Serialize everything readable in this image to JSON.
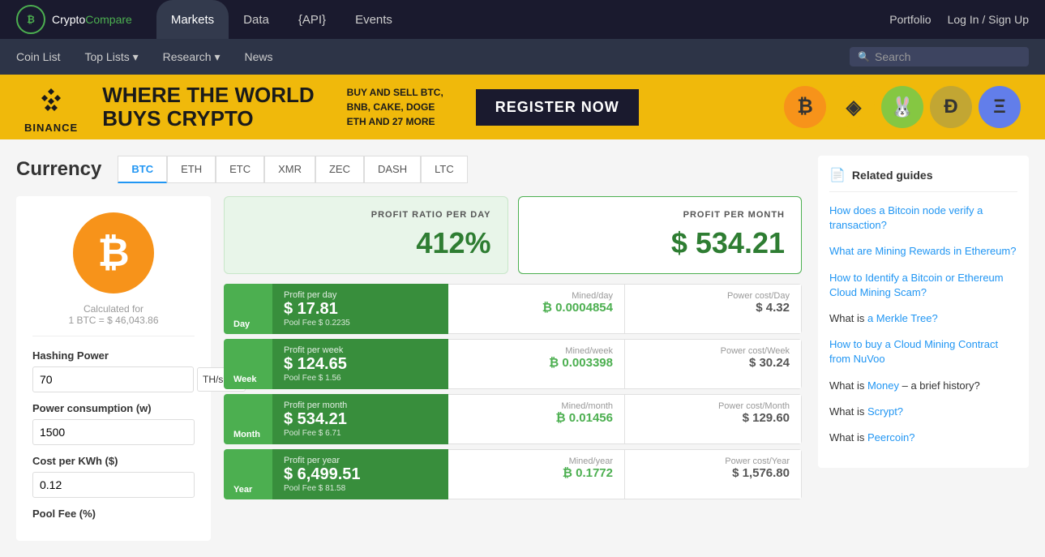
{
  "logo": {
    "crypto": "Crypto",
    "compare": "Compare",
    "icon": "₿"
  },
  "topNav": {
    "items": [
      {
        "label": "Markets",
        "active": true
      },
      {
        "label": "Data",
        "active": false
      },
      {
        "label": "{API}",
        "active": false
      },
      {
        "label": "Events",
        "active": false
      }
    ],
    "right": {
      "portfolio": "Portfolio",
      "login": "Log In / Sign Up"
    }
  },
  "secondaryNav": {
    "items": [
      {
        "label": "Coin List"
      },
      {
        "label": "Top Lists ▾"
      },
      {
        "label": "Research ▾"
      },
      {
        "label": "News"
      }
    ],
    "search": {
      "placeholder": "Search"
    }
  },
  "banner": {
    "binance": "BINANCE",
    "headline_line1": "WHERE THE WORLD",
    "headline_line2": "BUYS CRYPTO",
    "subtitle_line1": "BUY AND SELL BTC,",
    "subtitle_line2": "BNB, CAKE, DOGE",
    "subtitle_line3": "ETH AND 27 MORE",
    "cta": "REGISTER NOW",
    "coins": [
      "₿",
      "◈",
      "🐰",
      "Ð",
      "Ξ"
    ]
  },
  "currency": {
    "title": "Currency",
    "tabs": [
      "BTC",
      "ETH",
      "ETC",
      "XMR",
      "ZEC",
      "DASH",
      "LTC"
    ],
    "activeTab": "BTC"
  },
  "calculator": {
    "btcSymbol": "₿",
    "calculatedFor": "Calculated for",
    "btcRate": "1 BTC = $ 46,043.86",
    "hashingPower": {
      "label": "Hashing Power",
      "value": "70",
      "unit": "TH/s"
    },
    "powerConsumption": {
      "label": "Power consumption (w)",
      "value": "1500"
    },
    "costPerKwh": {
      "label": "Cost per KWh ($)",
      "value": "0.12"
    },
    "poolFee": {
      "label": "Pool Fee (%)"
    }
  },
  "profitBoxes": {
    "ratio": {
      "label": "PROFIT RATIO PER DAY",
      "value": "412%"
    },
    "monthly": {
      "label": "PROFIT PER MONTH",
      "value": "$ 534.21"
    }
  },
  "dataRows": [
    {
      "period": "Day",
      "profitLabel": "Profit per day",
      "profitValue": "$ 17.81",
      "poolFee": "Pool Fee $ 0.2235",
      "minedLabel": "Mined/day",
      "minedValue": "₿ 0.0004854",
      "costLabel": "Power cost/Day",
      "costValue": "$ 4.32"
    },
    {
      "period": "Week",
      "profitLabel": "Profit per week",
      "profitValue": "$ 124.65",
      "poolFee": "Pool Fee $ 1.56",
      "minedLabel": "Mined/week",
      "minedValue": "₿ 0.003398",
      "costLabel": "Power cost/Week",
      "costValue": "$ 30.24"
    },
    {
      "period": "Month",
      "profitLabel": "Profit per month",
      "profitValue": "$ 534.21",
      "poolFee": "Pool Fee $ 6.71",
      "minedLabel": "Mined/month",
      "minedValue": "₿ 0.01456",
      "costLabel": "Power cost/Month",
      "costValue": "$ 129.60"
    },
    {
      "period": "Year",
      "profitLabel": "Profit per year",
      "profitValue": "$ 6,499.51",
      "poolFee": "Pool Fee $ 81.58",
      "minedLabel": "Mined/year",
      "minedValue": "₿ 0.1772",
      "costLabel": "Power cost/Year",
      "costValue": "$ 1,576.80"
    }
  ],
  "relatedGuides": {
    "title": "Related guides",
    "items": [
      {
        "text": "How does a Bitcoin node verify a transaction?",
        "isLink": true
      },
      {
        "text": "What are Mining Rewards in Ethereum?",
        "isLink": true
      },
      {
        "text": "How to Identify a Bitcoin or Ethereum Cloud Mining Scam?",
        "isLink": true
      },
      {
        "text": "What is a Merkle Tree?",
        "isLink": false,
        "parts": [
          {
            "text": "What is ",
            "link": false
          },
          {
            "text": "a Merkle Tree?",
            "link": true
          }
        ]
      },
      {
        "text": "How to buy a Cloud Mining Contract from NuVoo",
        "isLink": true
      },
      {
        "text": "What is Money – a brief history?",
        "isLink": false,
        "parts": [
          {
            "text": "What is ",
            "link": false
          },
          {
            "text": "Money",
            "link": true
          },
          {
            "text": " – a brief history?",
            "link": false
          }
        ]
      },
      {
        "text": "What is Scrypt?",
        "isLink": false,
        "parts": [
          {
            "text": "What is ",
            "link": false
          },
          {
            "text": "Scrypt?",
            "link": true
          }
        ]
      },
      {
        "text": "What is Peercoin?",
        "isLink": false,
        "parts": [
          {
            "text": "What is ",
            "link": false
          },
          {
            "text": "Peercoin?",
            "link": true
          }
        ]
      }
    ]
  }
}
